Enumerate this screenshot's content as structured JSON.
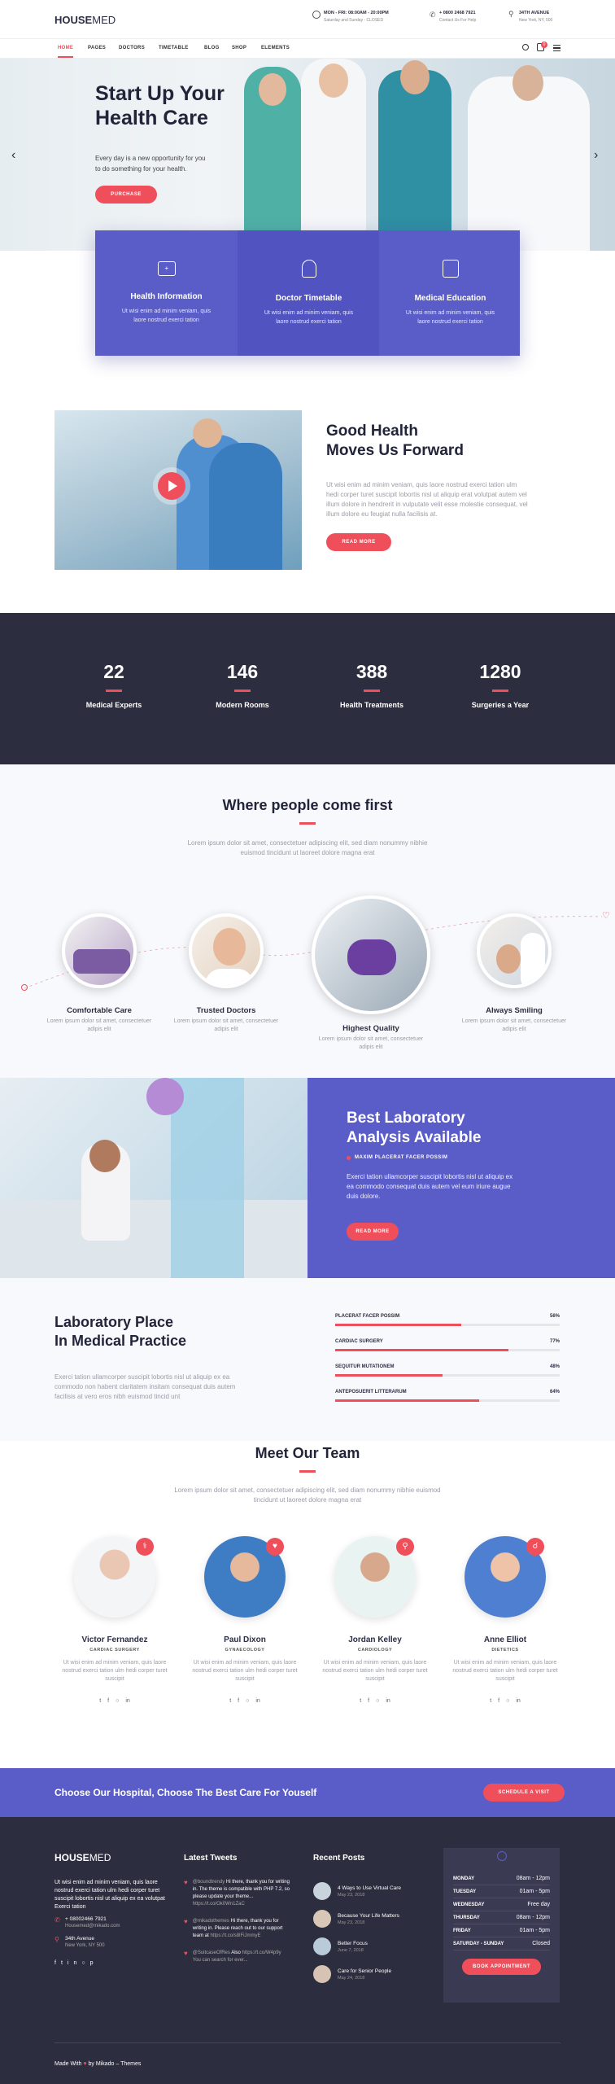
{
  "header": {
    "logo_bold": "HOUSE",
    "logo_light": "MED",
    "hours_title": "MON - FRI: 08:00AM - 20:00PM",
    "hours_sub": "Saturday and Sunday - CLOSED",
    "phone_title": "+ 0800 2468 7921",
    "phone_sub": "Contact Us For Help",
    "address_title": "34TH AVENUE",
    "address_sub": "New York, NY, 500"
  },
  "nav": {
    "items": [
      "HOME",
      "PAGES",
      "DOCTORS",
      "TIMETABLE",
      "BLOG",
      "SHOP",
      "ELEMENTS"
    ],
    "cart_count": "0"
  },
  "hero": {
    "title_line1": "Start Up Your",
    "title_line2": "Health Care",
    "text_line1": "Every day is a new opportunity for you",
    "text_line2": "to do something for your health.",
    "button": "PURCHASE"
  },
  "services": [
    {
      "icon": "first-aid-icon",
      "title": "Health Information",
      "text": "Ut wisi enim ad minim veniam, quis laore nostrud exerci tation"
    },
    {
      "icon": "doctor-icon",
      "title": "Doctor Timetable",
      "text": "Ut wisi enim ad minim veniam, quis laore nostrud exerci tation"
    },
    {
      "icon": "education-icon",
      "title": "Medical Education",
      "text": "Ut wisi enim ad minim veniam, quis laore nostrud exerci tation"
    }
  ],
  "about": {
    "title_line1": "Good Health",
    "title_line2": "Moves Us Forward",
    "text": "Ut wisi enim ad minim veniam, quis laore nostrud exerci tation ulm hedi corper turet suscipit lobortis nisl ut aliquip erat volutpat autem vel illum dolore in hendrerit in vulputate velit esse molestie consequat, vel illum dolore eu feugiat nulla facilisis at.",
    "button": "READ MORE"
  },
  "stats": [
    {
      "number": "22",
      "label": "Medical Experts"
    },
    {
      "number": "146",
      "label": "Modern Rooms"
    },
    {
      "number": "388",
      "label": "Health Treatments"
    },
    {
      "number": "1280",
      "label": "Surgeries a Year"
    }
  ],
  "people": {
    "title": "Where people come first",
    "text": "Lorem ipsum dolor sit amet, consectetuer adipiscing elit, sed diam nonummy nibhie euismod tincidunt ut laoreet dolore magna erat",
    "items": [
      {
        "title": "Comfortable Care",
        "text": "Lorem ipsum dolor sit amet, consectetuer adipis elit"
      },
      {
        "title": "Trusted Doctors",
        "text": "Lorem ipsum dolor sit amet, consectetuer adipis elit"
      },
      {
        "title": "Highest Quality",
        "text": "Lorem ipsum dolor sit amet, consectetuer adipis elit"
      },
      {
        "title": "Always Smiling",
        "text": "Lorem ipsum dolor sit amet, consectetuer adipis elit"
      }
    ]
  },
  "lab": {
    "title_line1": "Best Laboratory",
    "title_line2": "Analysis Available",
    "subtitle": "MAXIM PLACERAT FACER POSSIM",
    "text": "Exerci tation ullamcorper suscipit lobortis nisl ut aliquip ex ea commodo consequat duis autem vel eum iriure augue duis dolore.",
    "button": "READ MORE"
  },
  "practice": {
    "title_line1": "Laboratory Place",
    "title_line2": "In Medical Practice",
    "text": "Exerci tation ullamcorper suscipit lobortis nisl ut aliquip ex ea commodo non habent claritatem insitam consequat duis autem facilisis at vero eros nibh euismod tincid unt",
    "bars": [
      {
        "label": "PLACERAT FACER POSSIM",
        "percent_label": "56%",
        "percent": 56
      },
      {
        "label": "CARDIAC SURGERY",
        "percent_label": "77%",
        "percent": 77
      },
      {
        "label": "SEQUITUR MUTATIONEM",
        "percent_label": "48%",
        "percent": 48
      },
      {
        "label": "ANTEPOSUERIT LITTERARUM",
        "percent_label": "64%",
        "percent": 64
      }
    ]
  },
  "team": {
    "title": "Meet Our Team",
    "text": "Lorem ipsum dolor sit amet, consectetuer adipiscing elit, sed diam nonummy nibhie euismod tincidunt ut laoreet dolore magna erat",
    "members": [
      {
        "name": "Victor Fernandez",
        "role": "CARDIAC SURGERY",
        "text": "Ut wisi enim ad minim veniam, quis laore nostrud exerci tation ulm hedi corper turet suscipit"
      },
      {
        "name": "Paul Dixon",
        "role": "GYNAECOLOGY",
        "text": "Ut wisi enim ad minim veniam, quis laore nostrud exerci tation ulm hedi corper turet suscipit"
      },
      {
        "name": "Jordan Kelley",
        "role": "CARDIOLOGY",
        "text": "Ut wisi enim ad minim veniam, quis laore nostrud exerci tation ulm hedi corper turet suscipit"
      },
      {
        "name": "Anne Elliot",
        "role": "DIETETICS",
        "text": "Ut wisi enim ad minim veniam, quis laore nostrud exerci tation ulm hedi corper turet suscipit"
      }
    ]
  },
  "cta": {
    "text": "Choose Our Hospital, Choose The Best Care For Youself",
    "button": "SCHEDULE A VISIT"
  },
  "footer": {
    "logo_bold": "HOUSE",
    "logo_light": "MED",
    "about": "Ut wisi enim ad minim veniam, quis laore nostrud exerci tation ulm hedi corper turet suscipit lobortis nisl ut aliquip ex ea volutpat Exerci tation",
    "phone": "+ 08002466 7921",
    "email": "Housemed@mikado.com",
    "addr1": "34th Avenue",
    "addr2": "New York, NY 500",
    "tweets_title": "Latest Tweets",
    "tweets": [
      {
        "handle": "@boundtrendy",
        "text": "Hi there, thank you for writing in. The theme is compatible with PHP 7.2, so please update your theme...",
        "link": "https://t.co/Ok0Wn1ZaC"
      },
      {
        "handle": "@mikadothemes",
        "text": "Hi there, thank you for writing in. Please reach out to our support team at",
        "link": "https://t.co/s8lFiJmmyE"
      },
      {
        "handle": "@SuitcaseOfRes",
        "text": "Also",
        "link": "https://t.co/W4p9y You can search for ever..."
      }
    ],
    "posts_title": "Recent Posts",
    "posts": [
      {
        "title": "4 Ways to Use Virtual Care",
        "date": "May 23, 2018"
      },
      {
        "title": "Because Your Life Matters",
        "date": "May 23, 2018"
      },
      {
        "title": "Better Focus",
        "date": "June 7, 2018"
      },
      {
        "title": "Care for Senior People",
        "date": "May 24, 2018"
      }
    ],
    "hours": [
      {
        "day": "MONDAY",
        "time": "08am - 12pm"
      },
      {
        "day": "TUESDAY",
        "time": "01am - 5pm"
      },
      {
        "day": "WEDNESDAY",
        "time": "Free day"
      },
      {
        "day": "THURSDAY",
        "time": "08am - 12pm"
      },
      {
        "day": "FRIDAY",
        "time": "01am - 5pm"
      },
      {
        "day": "SATURDAY - SUNDAY",
        "time": "Closed"
      }
    ],
    "hours_button": "BOOK APPOINTMENT",
    "copyright_pre": "Made With",
    "copyright_post": "by Mikado – Themes"
  },
  "colors": {
    "accent": "#ef4f5b",
    "purple": "#5a5dc8",
    "dark": "#2c2d3e"
  }
}
